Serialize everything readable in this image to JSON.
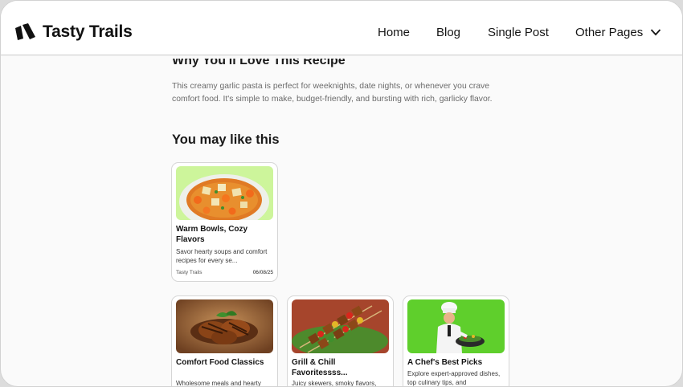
{
  "header": {
    "brand": "Tasty Trails",
    "nav": [
      "Home",
      "Blog",
      "Single Post",
      "Other Pages"
    ]
  },
  "article": {
    "clipped_heading": "Why You'll Love This Recipe",
    "paragraph": "This creamy garlic pasta is perfect for weeknights, date nights, or whenever you crave comfort food. It's simple to make, budget-friendly, and bursting with rich, garlicky flavor."
  },
  "related": {
    "title": "You may like this",
    "cards": [
      {
        "title": "Warm Bowls, Cozy Flavors",
        "desc": "Savor hearty soups and comfort recipes for every se...",
        "author": "Tasty Trails",
        "date": "06/08/25",
        "image": "soup-bowl-image"
      },
      {
        "title": "Comfort Food Classics",
        "desc": "Wholesome meals and hearty",
        "image": "grilled-chicken-image"
      },
      {
        "title": "Grill & Chill Favoritessss...",
        "desc": "Juicy skewers, smoky flavors,",
        "image": "skewers-image"
      },
      {
        "title": "A Chef's Best Picks",
        "desc": "Explore expert-approved dishes, top culinary tips, and",
        "image": "chef-image"
      }
    ]
  },
  "colors": {
    "soup_bg": "#cdf59b",
    "chicken_bg": "#8a5a34",
    "skewer_bg": "#a6452c",
    "chef_bg": "#5fcf2c"
  }
}
